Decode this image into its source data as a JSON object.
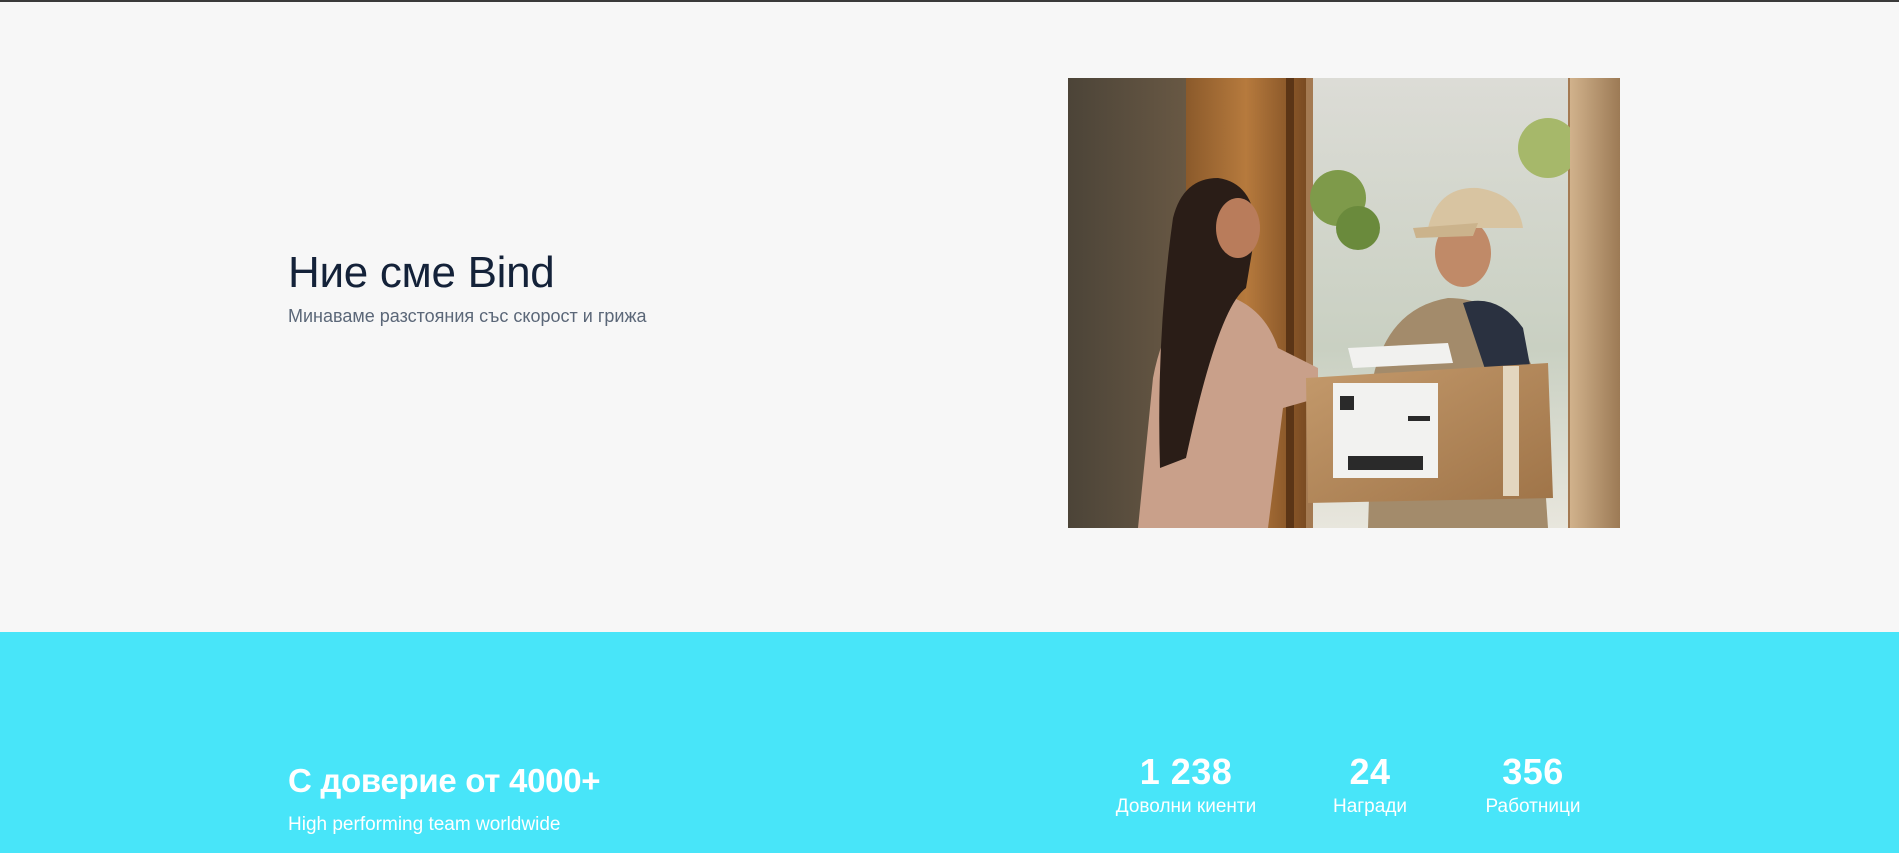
{
  "hero": {
    "title": "Ние сме Bind",
    "subtitle": "Минаваме разстояния със скорост и грижа",
    "image_subject": "delivery-photo"
  },
  "trust": {
    "title": "С доверие от 4000+",
    "subtitle": "High performing team worldwide"
  },
  "stats": [
    {
      "value": "1 238",
      "label": "Доволни киенти"
    },
    {
      "value": "24",
      "label": "Награди"
    },
    {
      "value": "356",
      "label": "Работници"
    }
  ],
  "colors": {
    "hero_background": "#f7f7f7",
    "stats_background": "#48e5f9",
    "heading_text": "#142239",
    "subtitle_text": "#5b6778",
    "stats_text": "#ffffff"
  }
}
